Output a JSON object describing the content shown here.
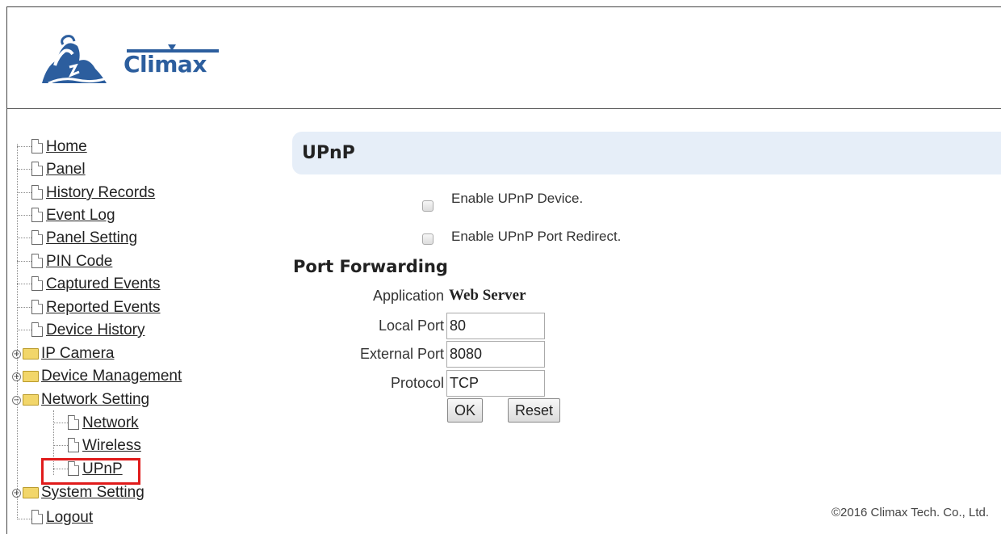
{
  "brand": {
    "name": "Climax"
  },
  "nav": {
    "home": "Home",
    "panel": "Panel",
    "history_records": "History Records",
    "event_log": "Event Log",
    "panel_setting": "Panel Setting",
    "pin_code": "PIN Code",
    "captured_events": "Captured Events",
    "reported_events": "Reported Events",
    "device_history": "Device History",
    "ip_camera": "IP Camera",
    "device_management": "Device Management",
    "network_setting": "Network Setting",
    "network": "Network",
    "wireless": "Wireless",
    "upnp": "UPnP",
    "system_setting": "System Setting",
    "logout": "Logout",
    "toggle_collapsed": "+",
    "toggle_expanded": "−"
  },
  "page": {
    "title": "UPnP"
  },
  "options": {
    "enable_device": {
      "label": "Enable UPnP Device.",
      "checked": false
    },
    "enable_redirect": {
      "label": "Enable UPnP Port Redirect.",
      "checked": false
    }
  },
  "port_forwarding": {
    "heading": "Port Forwarding",
    "application_label": "Application",
    "application_value": "Web Server",
    "local_port_label": "Local Port",
    "local_port_value": "80",
    "external_port_label": "External Port",
    "external_port_value": "8080",
    "protocol_label": "Protocol",
    "protocol_value": "TCP",
    "ok_label": "OK",
    "reset_label": "Reset"
  },
  "footer": {
    "copyright": "©2016 Climax Tech. Co., Ltd."
  }
}
